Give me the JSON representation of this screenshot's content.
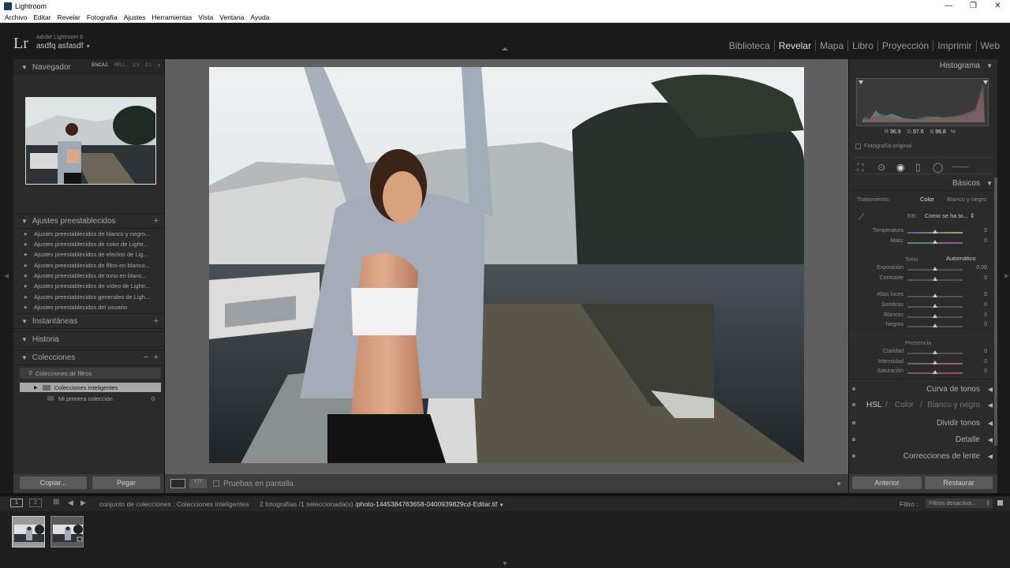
{
  "window": {
    "title": "Lightroom",
    "controls": [
      "—",
      "❐",
      "✕"
    ]
  },
  "menu": [
    "Archivo",
    "Editar",
    "Revelar",
    "Fotografía",
    "Ajustes",
    "Herramientas",
    "Vista",
    "Ventana",
    "Ayuda"
  ],
  "identity": {
    "logo": "Lr",
    "version": "Adobe Lightroom 6",
    "user": "asdfq asfasdf"
  },
  "modules": [
    "Biblioteca",
    "Revelar",
    "Mapa",
    "Libro",
    "Proyección",
    "Imprimir",
    "Web"
  ],
  "active_module": "Revelar",
  "navigator": {
    "title": "Navegador",
    "modes": [
      "ENCAJ.",
      "RELL.",
      "1:1",
      "3:1"
    ]
  },
  "presets": {
    "title": "Ajustes preestablecidos",
    "items": [
      "Ajustes preestablecidos de blanco y negro...",
      "Ajustes preestablecidos de color de Lightr...",
      "Ajustes preestablecidos de efectos de Lig...",
      "Ajustes preestablecidos de filtro en blanco...",
      "Ajustes preestablecidos de tono en blanc...",
      "Ajustes preestablecidos de vídeo de Lightr...",
      "Ajustes preestablecidos generales de Ligh...",
      "Ajustes preestablecidos del usuario"
    ]
  },
  "snapshots": {
    "title": "Instantáneas"
  },
  "history": {
    "title": "Historia"
  },
  "collections": {
    "title": "Colecciones",
    "filter": "Colecciones de filtros",
    "items": [
      {
        "label": "Colecciones inteligentes",
        "count": ""
      },
      {
        "label": "Mi primera colección",
        "count": "0"
      }
    ]
  },
  "left_buttons": {
    "copy": "Copiar...",
    "paste": "Pegar"
  },
  "toolbar": {
    "softproof": "Pruebas en pantalla"
  },
  "right_buttons": {
    "previous": "Anterior",
    "reset": "Restaurar"
  },
  "histogram": {
    "title": "Histograma",
    "r_label": "R",
    "r_val": "96.9",
    "g_label": "G",
    "g_val": "97.6",
    "b_label": "B",
    "b_val": "96.8",
    "unit": "%",
    "original": "Fotografía original"
  },
  "basics": {
    "title": "Básicos",
    "treatment_label": "Tratamiento:",
    "treatment_color": "Color",
    "treatment_bw": "Blanco y negro",
    "wb_label": "EB:",
    "wb_value": "Como se ha to...",
    "tone_label": "Tono",
    "auto": "Automático",
    "presence": "Presencia",
    "sliders": [
      {
        "name": "Temperatura",
        "value": "0"
      },
      {
        "name": "Matiz",
        "value": "0"
      },
      {
        "name": "Exposición",
        "value": "0.00"
      },
      {
        "name": "Contraste",
        "value": "0"
      },
      {
        "name": "Altas luces",
        "value": "0"
      },
      {
        "name": "Sombras",
        "value": "0"
      },
      {
        "name": "Blancos",
        "value": "0"
      },
      {
        "name": "Negros",
        "value": "0"
      },
      {
        "name": "Claridad",
        "value": "0"
      },
      {
        "name": "Intensidad",
        "value": "0"
      },
      {
        "name": "Saturación",
        "value": "0"
      }
    ]
  },
  "right_sections": {
    "curve": "Curva de tonos",
    "hsl": "HSL",
    "color": "Color",
    "bw": "Blanco y negro",
    "split": "Dividir tonos",
    "detail": "Detalle",
    "lens": "Correcciones de lente"
  },
  "filmstrip_bar": {
    "page1": "1",
    "page2": "2",
    "source": "conjunto de colecciones : Colecciones inteligentes",
    "count": "2 fotografías /1 seleccionada(s) /",
    "filename": "photo-1445384763658-0400939829cd-Editar.tif",
    "filter_label": "Filtro :",
    "filter_value": "Filtros desactiva..."
  }
}
